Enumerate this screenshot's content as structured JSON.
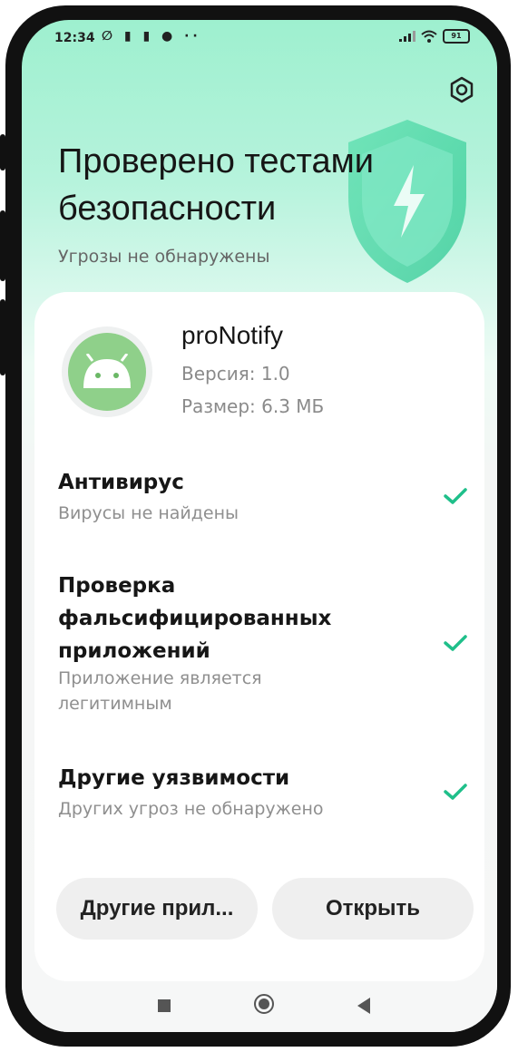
{
  "status_bar": {
    "time": "12:34",
    "left_icons": "∅ ▮ ▮ ● ··",
    "battery": "91"
  },
  "header": {
    "title": "Проверено тестами безопасности",
    "subtitle": "Угрозы не обнаружены"
  },
  "app": {
    "name": "proNotify",
    "version": "Версия: 1.0",
    "size": "Размер: 6.3 МБ"
  },
  "checks": [
    {
      "title": "Антивирус",
      "description": "Вирусы не найдены"
    },
    {
      "title": "Проверка фальсифицированных приложений",
      "description": "Приложение является легитимным"
    },
    {
      "title": "Другие уязвимости",
      "description": "Других угроз не обнаружено"
    }
  ],
  "buttons": {
    "other_apps": "Другие прил...",
    "open": "Открыть"
  },
  "colors": {
    "accent": "#1fbf8a",
    "header_gradient_top": "#9ef0cf"
  },
  "icons": {
    "settings": "gear-icon",
    "shield": "shield-icon",
    "check": "check-icon",
    "app": "android-icon"
  }
}
